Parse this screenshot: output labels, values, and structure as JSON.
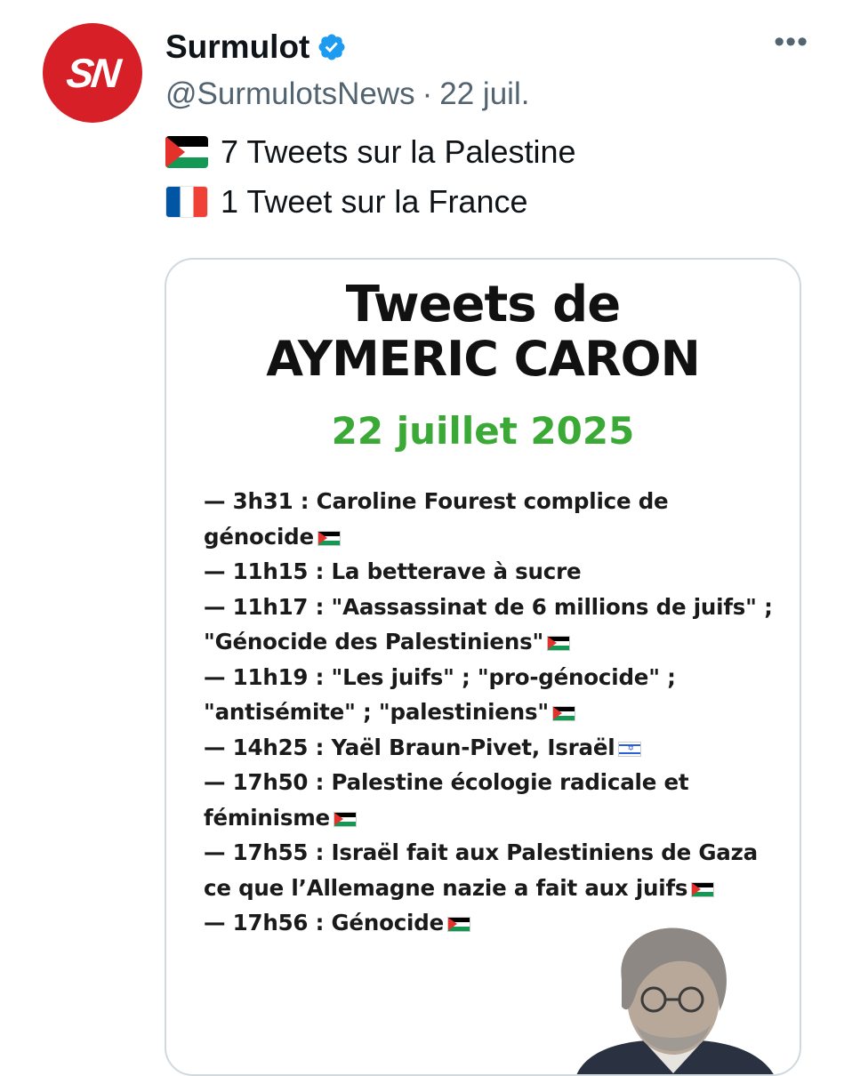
{
  "account": {
    "avatar_text": "SN",
    "display_name": "Surmulot",
    "handle": "@SurmulotsNews",
    "separator": "·",
    "date": "22 juil.",
    "more": "•••"
  },
  "tweet": {
    "lines": [
      {
        "flag": "palestine-flag-icon",
        "text": "7 Tweets sur la Palestine"
      },
      {
        "flag": "france-flag-icon",
        "text": "1 Tweet sur la France"
      }
    ]
  },
  "media": {
    "title_line1": "Tweets de",
    "title_line2": "AYMERIC CARON",
    "date": "22 juillet 2025",
    "entries": [
      "— 3h31 : Caroline Fourest complice de",
      "génocide",
      "— 11h15 : La betterave à sucre",
      "— 11h17 : \"Aassassinat de 6 millions de juifs\" ;",
      "\"Génocide des Palestiniens\"",
      "— 11h19 : \"Les juifs\" ; \"pro-génocide\" ;",
      "\"antisémite\" ; \"palestiniens\"",
      "— 14h25 : Yaël Braun-Pivet, Israël",
      "— 17h50 : Palestine écologie radicale et",
      "féminisme",
      "— 17h55 : Israël fait aux Palestiniens de Gaza",
      "ce que l’Allemagne nazie a fait aux juifs",
      "— 17h56 : Génocide"
    ]
  },
  "colors": {
    "avatar_bg": "#d61f26",
    "verified": "#1d9bf0",
    "date_green": "#3aa935",
    "muted": "#536471"
  }
}
